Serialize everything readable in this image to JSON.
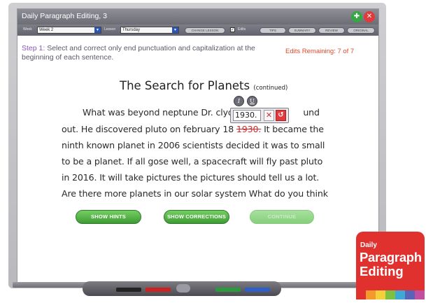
{
  "app": {
    "title": "Daily Paragraph Editing, 3"
  },
  "toolbar": {
    "week_label": "Week",
    "week_value": "Week 2",
    "lesson_label": "Lesson",
    "lesson_value": "Thursday",
    "change_lesson": "CHANGE LESSON",
    "edits_label": "Edits",
    "tips": "TIPS",
    "summary": "SUMMARY",
    "review": "REVIEW",
    "original": "ORIGINAL"
  },
  "instructions": {
    "step_label": "Step 1:",
    "step_text": "Select and correct only end punctuation and capitalization at the beginning of each sentence.",
    "edits_remaining": "Edits Remaining: 7 of 7"
  },
  "passage": {
    "title": "The Search for Planets",
    "title_suffix": "(continued)",
    "line1_a": "What was beyond neptune Dr. clyde",
    "line1_b": "und",
    "line2_a": "out. He discovered pluto on february 18 ",
    "line2_struck": "1930.",
    "line2_b": " It became the",
    "line3": "ninth known planet in 2006 scientists decided it was to small",
    "line4": "to be a planet. If all gose well, a spacecraft will fly past pluto",
    "line5": "in 2016. It will take pictures the pictures should tell us a lot.",
    "line6": "Are there more planets in our solar system What do you think"
  },
  "edit_popup": {
    "italic": "I",
    "underline": "U",
    "input_value": "1930.",
    "cancel": "✕",
    "undo": "↺"
  },
  "buttons": {
    "show_hints": "SHOW HINTS",
    "show_corrections": "SHOW CORRECTIONS",
    "continue": "CONTINUE"
  },
  "logo": {
    "line1": "Daily",
    "line2": "Paragraph",
    "line3": "Editing",
    "stripe_colors": [
      "#e0312f",
      "#f29a2e",
      "#f4d13a",
      "#7cc143",
      "#3fa9d6",
      "#5a63b8",
      "#c34fa0"
    ]
  },
  "icons": {
    "help": "help-icon",
    "close": "close-icon"
  },
  "colors": {
    "accent_purple": "#8a58b8",
    "alert_red": "#e04a2a",
    "button_green": "#3e9b33",
    "brand_red": "#e0312f"
  }
}
